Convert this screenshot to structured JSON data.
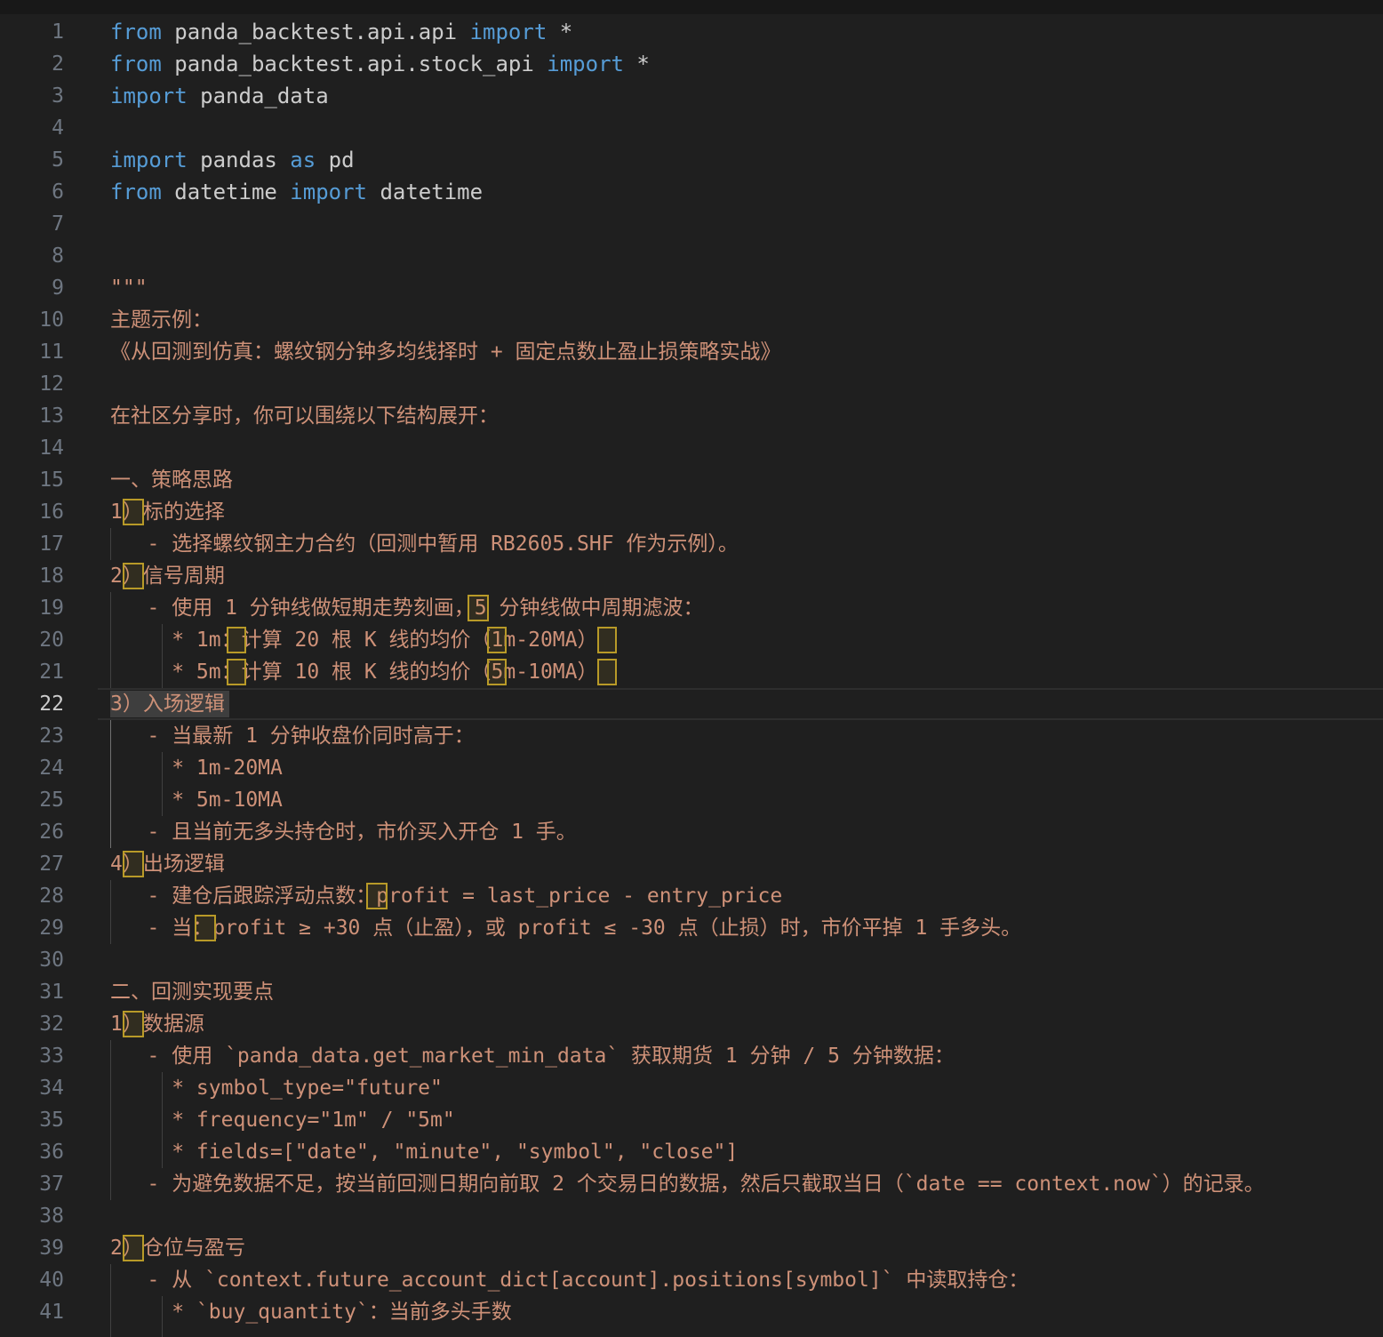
{
  "editor": {
    "lines": [
      {
        "n": "1",
        "t": "code",
        "parts": [
          {
            "k": "kw",
            "v": "from"
          },
          {
            "k": "tx",
            "v": " panda_backtest.api.api "
          },
          {
            "k": "kw",
            "v": "import"
          },
          {
            "k": "tx",
            "v": " *"
          }
        ]
      },
      {
        "n": "2",
        "t": "code",
        "parts": [
          {
            "k": "kw",
            "v": "from"
          },
          {
            "k": "tx",
            "v": " panda_backtest.api.stock_api "
          },
          {
            "k": "kw",
            "v": "import"
          },
          {
            "k": "tx",
            "v": " *"
          }
        ]
      },
      {
        "n": "3",
        "t": "code",
        "parts": [
          {
            "k": "kw",
            "v": "import"
          },
          {
            "k": "tx",
            "v": " panda_data"
          }
        ]
      },
      {
        "n": "4",
        "t": "code",
        "parts": []
      },
      {
        "n": "5",
        "t": "code",
        "parts": [
          {
            "k": "kw",
            "v": "import"
          },
          {
            "k": "tx",
            "v": " pandas "
          },
          {
            "k": "kw",
            "v": "as"
          },
          {
            "k": "tx",
            "v": " pd"
          }
        ]
      },
      {
        "n": "6",
        "t": "code",
        "parts": [
          {
            "k": "kw",
            "v": "from"
          },
          {
            "k": "tx",
            "v": " datetime "
          },
          {
            "k": "kw",
            "v": "import"
          },
          {
            "k": "tx",
            "v": " datetime"
          }
        ]
      },
      {
        "n": "7",
        "t": "code",
        "parts": []
      },
      {
        "n": "8",
        "t": "code",
        "parts": []
      },
      {
        "n": "9",
        "t": "comment",
        "text": "\"\"\""
      },
      {
        "n": "10",
        "t": "comment",
        "text": "主题示例："
      },
      {
        "n": "11",
        "t": "comment",
        "text": "《从回测到仿真：螺纹钢分钟多均线择时 + 固定点数止盈止损策略实战》"
      },
      {
        "n": "12",
        "t": "comment",
        "text": ""
      },
      {
        "n": "13",
        "t": "comment",
        "text": "在社区分享时，你可以围绕以下结构展开："
      },
      {
        "n": "14",
        "t": "comment",
        "text": ""
      },
      {
        "n": "15",
        "t": "comment",
        "text": "一、策略思路"
      },
      {
        "n": "16",
        "t": "comment",
        "text": "1）标的选择"
      },
      {
        "n": "17",
        "t": "comment",
        "text": "   - 选择螺纹钢主力合约（回测中暂用 RB2605.SHF 作为示例）。"
      },
      {
        "n": "18",
        "t": "comment",
        "text": "2）信号周期"
      },
      {
        "n": "19",
        "t": "comment",
        "text": "   - 使用 1 分钟线做短期走势刻画，5 分钟线做中周期滤波："
      },
      {
        "n": "20",
        "t": "comment",
        "text": "     * 1m：计算 20 根 K 线的均价（1m-20MA）"
      },
      {
        "n": "21",
        "t": "comment",
        "text": "     * 5m：计算 10 根 K 线的均价（5m-10MA）"
      },
      {
        "n": "22",
        "t": "comment",
        "text": "3）入场逻辑",
        "current": true
      },
      {
        "n": "23",
        "t": "comment",
        "text": "   - 当最新 1 分钟收盘价同时高于："
      },
      {
        "n": "24",
        "t": "comment",
        "text": "     * 1m-20MA"
      },
      {
        "n": "25",
        "t": "comment",
        "text": "     * 5m-10MA"
      },
      {
        "n": "26",
        "t": "comment",
        "text": "   - 且当前无多头持仓时，市价买入开仓 1 手。"
      },
      {
        "n": "27",
        "t": "comment",
        "text": "4）出场逻辑"
      },
      {
        "n": "28",
        "t": "comment",
        "text": "   - 建仓后跟踪浮动点数：profit = last_price - entry_price"
      },
      {
        "n": "29",
        "t": "comment",
        "text": "   - 当：profit ≥ +30 点（止盈），或 profit ≤ -30 点（止损）时，市价平掉 1 手多头。"
      },
      {
        "n": "30",
        "t": "comment",
        "text": ""
      },
      {
        "n": "31",
        "t": "comment",
        "text": "二、回测实现要点"
      },
      {
        "n": "32",
        "t": "comment",
        "text": "1）数据源"
      },
      {
        "n": "33",
        "t": "comment",
        "text": "   - 使用 `panda_data.get_market_min_data` 获取期货 1 分钟 / 5 分钟数据："
      },
      {
        "n": "34",
        "t": "comment",
        "text": "     * symbol_type=\"future\""
      },
      {
        "n": "35",
        "t": "comment",
        "text": "     * frequency=\"1m\" / \"5m\""
      },
      {
        "n": "36",
        "t": "comment",
        "text": "     * fields=[\"date\", \"minute\", \"symbol\", \"close\"]"
      },
      {
        "n": "37",
        "t": "comment",
        "text": "   - 为避免数据不足，按当前回测日期向前取 2 个交易日的数据，然后只截取当日（`date == context.now`）的记录。"
      },
      {
        "n": "38",
        "t": "comment",
        "text": ""
      },
      {
        "n": "39",
        "t": "comment",
        "text": "2）仓位与盈亏"
      },
      {
        "n": "40",
        "t": "comment",
        "text": "   - 从 `context.future_account_dict[account].positions[symbol]` 中读取持仓："
      },
      {
        "n": "41",
        "t": "comment",
        "text": "     * `buy_quantity`：当前多头手数"
      }
    ]
  },
  "colors": {
    "background": "#1f1f1f",
    "keyword": "#569cd6",
    "identifier": "#cccccc",
    "docstring": "#ce9178",
    "line_number": "#6e7681",
    "bracket_highlight": "#b89a28"
  }
}
